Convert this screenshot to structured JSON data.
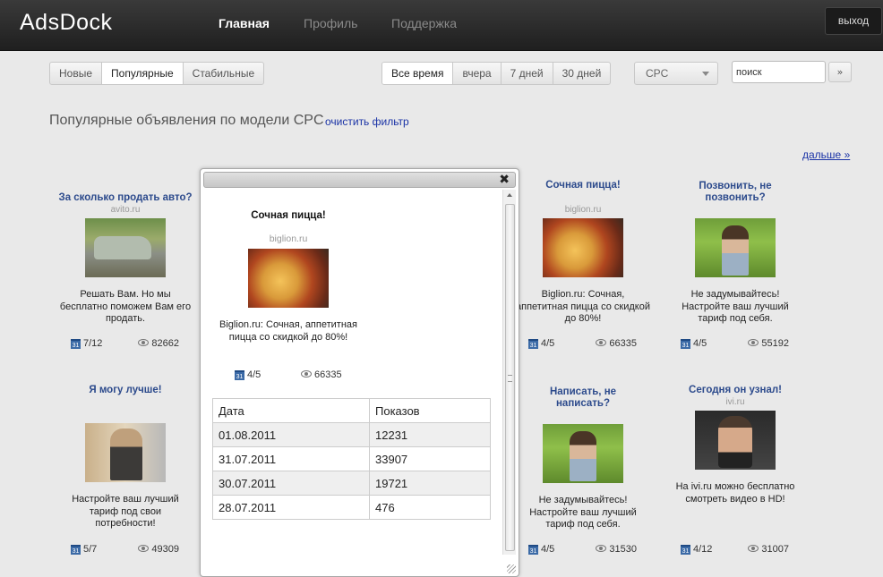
{
  "app": {
    "logo": "AdsDock",
    "logout": "выход"
  },
  "nav": [
    {
      "label": "Главная",
      "active": true
    },
    {
      "label": "Профиль",
      "active": false
    },
    {
      "label": "Поддержка",
      "active": false
    }
  ],
  "filters": {
    "type": [
      "Новые",
      "Популярные",
      "Стабильные"
    ],
    "type_selected": "Популярные",
    "period": [
      "Все время",
      "вчера",
      "7 дней",
      "30 дней"
    ],
    "period_selected": "Все время",
    "model_select": "CPC",
    "search_value": "поиск",
    "search_go": "»"
  },
  "heading": "Популярные объявления по модели CPC",
  "clear_filter": "очистить фильтр",
  "next": "дальше »",
  "cards": [
    {
      "title": "За сколько продать авто?",
      "domain": "avito.ru",
      "text": "Решать Вам. Но мы бесплатно поможем Вам его продать.",
      "days": "7/12",
      "views": "82662",
      "image": "car"
    },
    {
      "title": "Я могу лучше!",
      "domain": "",
      "text": "Настройте ваш лучший тариф под свои потребности!",
      "days": "5/7",
      "views": "49309",
      "image": "old-man"
    },
    {
      "title": "Сочная пицца!",
      "domain": "biglion.ru",
      "text": "Biglion.ru: Сочная, аппетитная пицца со скидкой до 80%!",
      "days": "4/5",
      "views": "66335",
      "image": "pizza"
    },
    {
      "title": "Позвонить, не позвонить?",
      "domain": "",
      "text": "Не задумывайтесь! Настройте ваш лучший тариф под себя.",
      "days": "4/5",
      "views": "55192",
      "image": "young-man"
    },
    {
      "title": "Написать, не написать?",
      "domain": "",
      "text": "Не задумывайтесь! Настройте ваш лучший тариф под себя.",
      "days": "4/5",
      "views": "31530",
      "image": "young-man"
    },
    {
      "title": "Сегодня он узнал!",
      "domain": "ivi.ru",
      "text": "На ivi.ru можно бесплатно смотреть видео в HD!",
      "days": "4/12",
      "views": "31007",
      "image": "actor"
    }
  ],
  "popup": {
    "title": "Сочная пицца!",
    "domain": "biglion.ru",
    "text": "Biglion.ru: Сочная, аппетитная пицца со скидкой до 80%!",
    "days": "4/5",
    "views": "66335",
    "table": {
      "headers": [
        "Дата",
        "Показов"
      ],
      "rows": [
        [
          "01.08.2011",
          "12231"
        ],
        [
          "31.07.2011",
          "33907"
        ],
        [
          "30.07.2011",
          "19721"
        ],
        [
          "28.07.2011",
          "476"
        ]
      ]
    }
  },
  "icons": {
    "calendar": "calendar-icon",
    "views": "eye-icon",
    "close": "close-icon"
  }
}
